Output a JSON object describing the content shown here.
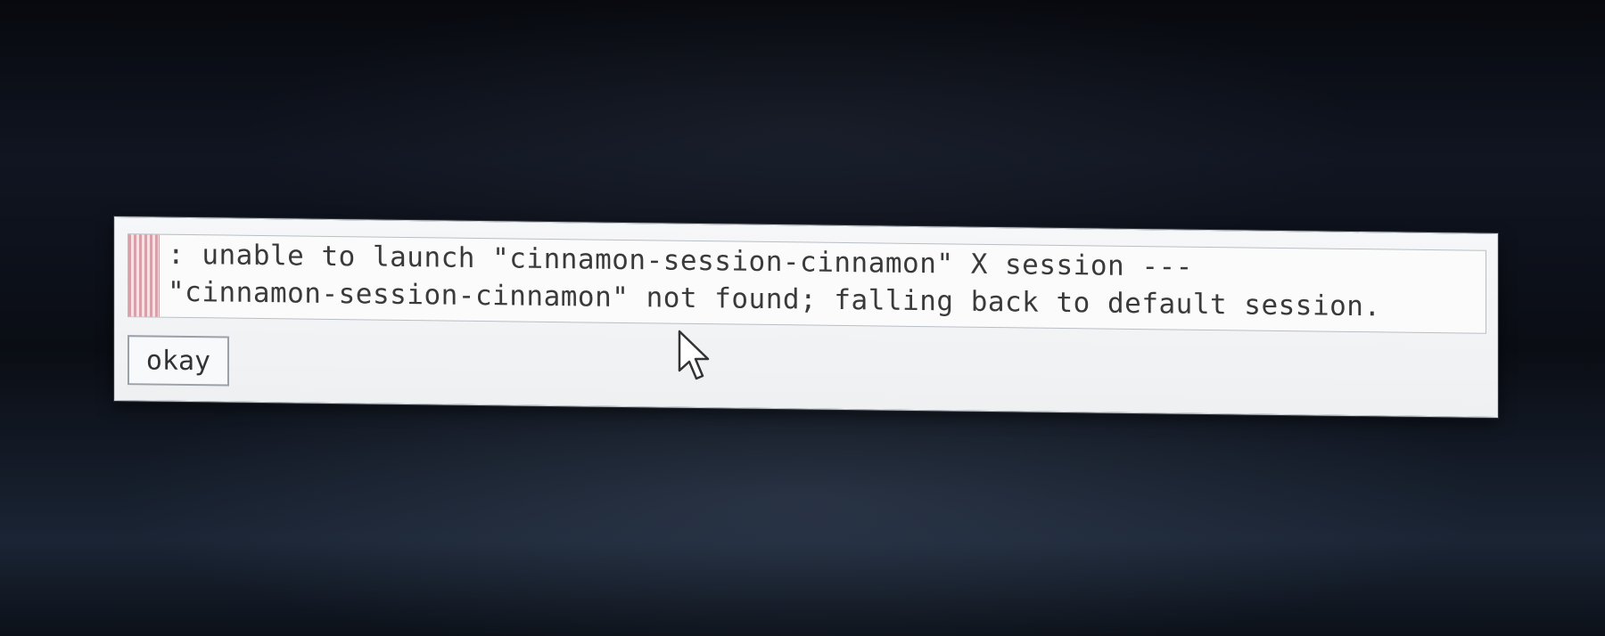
{
  "dialog": {
    "message_line1": ": unable to launch \"cinnamon-session-cinnamon\" X session ---",
    "message_line2": "\"cinnamon-session-cinnamon\" not found; falling back to default session.",
    "button_label": "okay"
  },
  "icons": {
    "cursor": "arrow-cursor-icon"
  },
  "colors": {
    "background": "#0b0f17",
    "dialog_bg": "#f6f7f8",
    "text": "#3a3a3a",
    "scrollbar_stripes": "#d8a0a8"
  }
}
